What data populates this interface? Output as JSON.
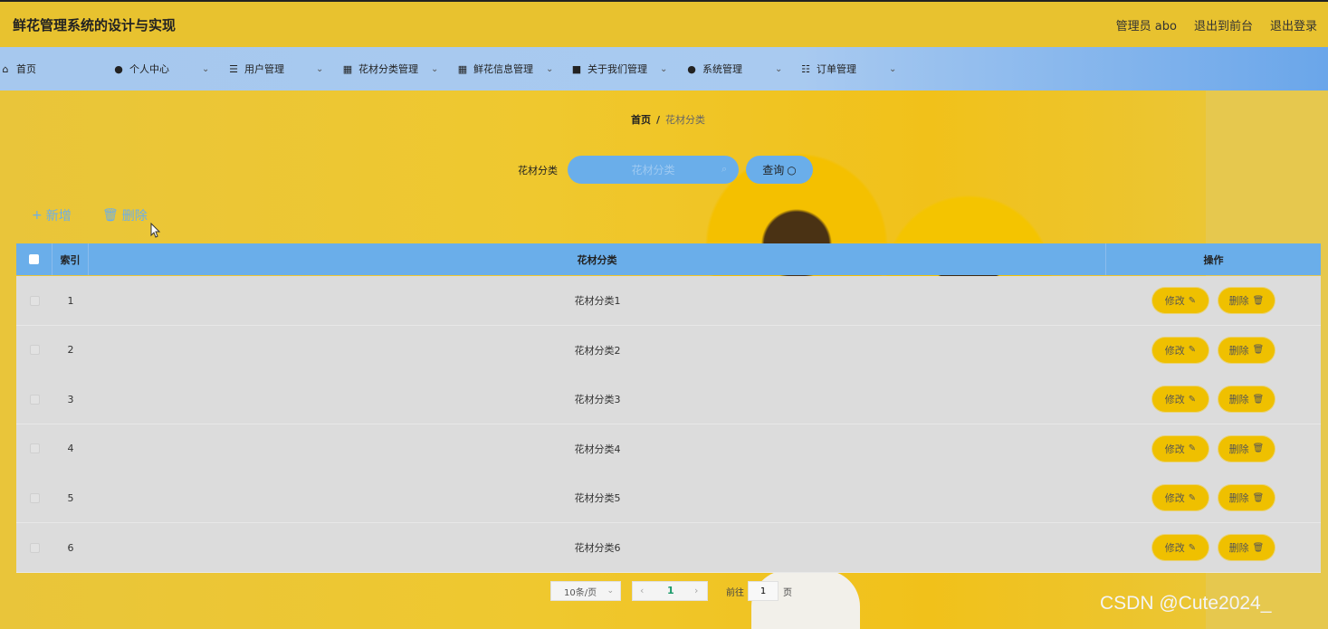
{
  "header": {
    "title": "鲜花管理系统的设计与实现",
    "admin": "管理员 abo",
    "to_front": "退出到前台",
    "logout": "退出登录"
  },
  "nav": [
    {
      "label": "首页",
      "icon": "home-icon",
      "dropdown": false
    },
    {
      "label": "个人中心",
      "icon": "user-icon",
      "dropdown": true
    },
    {
      "label": "用户管理",
      "icon": "list-icon",
      "dropdown": true
    },
    {
      "label": "花材分类管理",
      "icon": "grid-icon",
      "dropdown": true
    },
    {
      "label": "鲜花信息管理",
      "icon": "grid-icon",
      "dropdown": true
    },
    {
      "label": "关于我们管理",
      "icon": "briefcase-icon",
      "dropdown": true
    },
    {
      "label": "系统管理",
      "icon": "user-icon",
      "dropdown": true
    },
    {
      "label": "订单管理",
      "icon": "sliders-icon",
      "dropdown": true
    }
  ],
  "breadcrumb": {
    "home": "首页",
    "sep": "/",
    "current": "花材分类"
  },
  "search": {
    "label": "花材分类",
    "placeholder": "花材分类",
    "button": "查询"
  },
  "actions": {
    "add": "新增",
    "delete": "删除"
  },
  "table": {
    "headers": {
      "index": "索引",
      "category": "花材分类",
      "ops": "操作"
    },
    "rows": [
      {
        "index": "1",
        "category": "花材分类1"
      },
      {
        "index": "2",
        "category": "花材分类2"
      },
      {
        "index": "3",
        "category": "花材分类3"
      },
      {
        "index": "4",
        "category": "花材分类4"
      },
      {
        "index": "5",
        "category": "花材分类5"
      },
      {
        "index": "6",
        "category": "花材分类6"
      }
    ],
    "edit_label": "修改",
    "delete_label": "删除"
  },
  "pagination": {
    "page_size": "10条/页",
    "current_page": "1",
    "goto_label": "前往",
    "goto_value": "1",
    "page_suffix": "页"
  },
  "watermark": "CSDN @Cute2024_",
  "colors": {
    "header_bg": "#e8c22f",
    "nav_bg": "#a6c8ee",
    "accent_blue": "#6aaeea",
    "button_yellow": "#efc000"
  }
}
